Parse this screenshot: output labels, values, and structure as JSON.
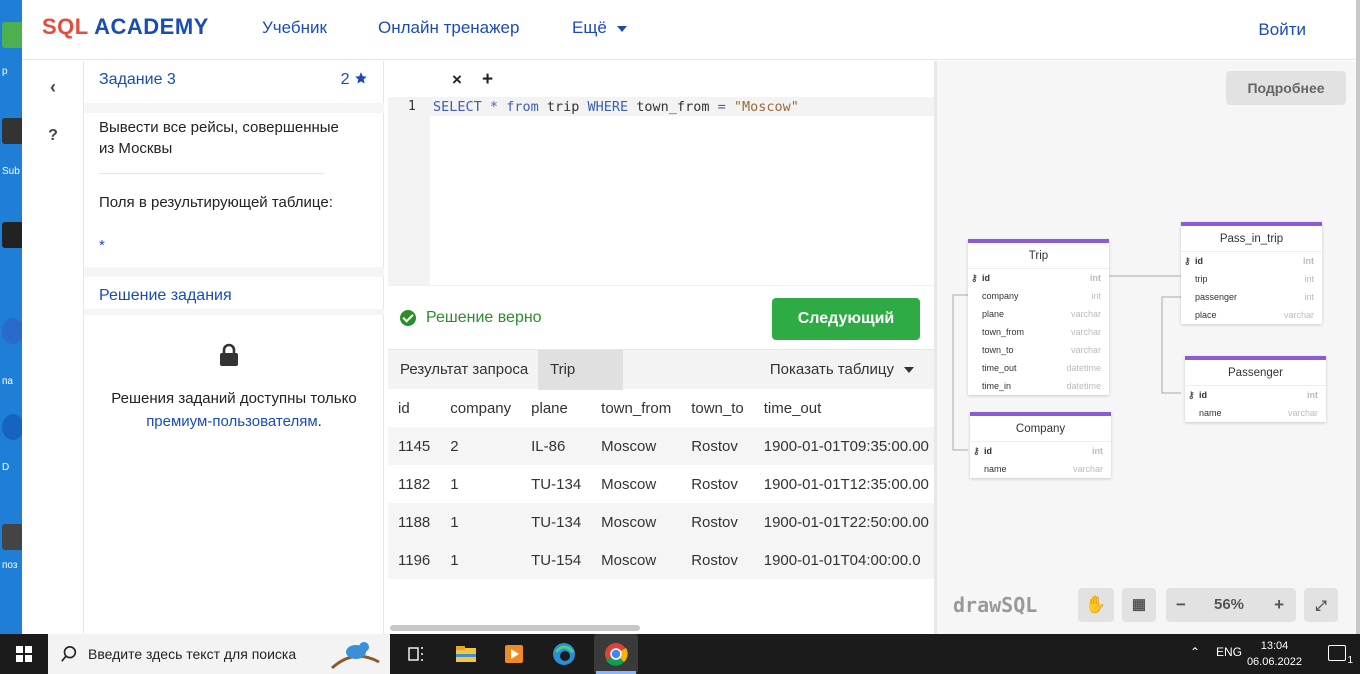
{
  "header": {
    "logo_sql": "SQL",
    "logo_academy": "ACADEMY",
    "nav": [
      "Учебник",
      "Онлайн тренажер",
      "Ещё"
    ],
    "login": "Войти"
  },
  "desktop_labels": [
    "р",
    "Sub",
    "па",
    "D",
    "поз"
  ],
  "mini": {
    "back": "‹",
    "help": "?"
  },
  "task": {
    "title": "Задание 3",
    "score": "2",
    "description": "Вывести все рейсы, совершенные из Москвы",
    "fields_label": "Поля в результирующей таблице:",
    "fields_value": "*",
    "solution_title": "Решение задания",
    "solution_note": "Решения заданий доступны только",
    "solution_link": "премиум-пользователям",
    "solution_dot": "."
  },
  "editor": {
    "close_tab": "×",
    "add_tab": "+",
    "line_number": "1",
    "code": {
      "kw1": "SELECT",
      "star": "*",
      "kw2": "from",
      "table": "trip",
      "kw3": "WHERE",
      "col": "town_from",
      "eq": "=",
      "str": "\"Moscow\""
    }
  },
  "result": {
    "status": "Решение верно",
    "next_button": "Следующий",
    "tabs": [
      "Результат запроса",
      "Trip"
    ],
    "show_table": "Показать таблицу",
    "columns": [
      "id",
      "company",
      "plane",
      "town_from",
      "town_to",
      "time_out"
    ],
    "rows": [
      [
        "1145",
        "2",
        "IL-86",
        "Moscow",
        "Rostov",
        "1900-01-01T09:35:00.00"
      ],
      [
        "1182",
        "1",
        "TU-134",
        "Moscow",
        "Rostov",
        "1900-01-01T12:35:00.00"
      ],
      [
        "1188",
        "1",
        "TU-134",
        "Moscow",
        "Rostov",
        "1900-01-01T22:50:00.00"
      ],
      [
        "1196",
        "1",
        "TU-154",
        "Moscow",
        "Rostov",
        "1900-01-01T04:00:00.0"
      ]
    ]
  },
  "diagram": {
    "more_button": "Подробнее",
    "brand": "drawSQL",
    "zoom": "56%",
    "entities": {
      "trip": {
        "title": "Trip",
        "fields": [
          {
            "name": "id",
            "type": "int"
          },
          {
            "name": "company",
            "type": "int"
          },
          {
            "name": "plane",
            "type": "varchar"
          },
          {
            "name": "town_from",
            "type": "varchar"
          },
          {
            "name": "town_to",
            "type": "varchar"
          },
          {
            "name": "time_out",
            "type": "datetime"
          },
          {
            "name": "time_in",
            "type": "datetime"
          }
        ]
      },
      "pass_in_trip": {
        "title": "Pass_in_trip",
        "fields": [
          {
            "name": "id",
            "type": "int"
          },
          {
            "name": "trip",
            "type": "int"
          },
          {
            "name": "passenger",
            "type": "int"
          },
          {
            "name": "place",
            "type": "varchar"
          }
        ]
      },
      "passenger": {
        "title": "Passenger",
        "fields": [
          {
            "name": "id",
            "type": "int"
          },
          {
            "name": "name",
            "type": "varchar"
          }
        ]
      },
      "company": {
        "title": "Company",
        "fields": [
          {
            "name": "id",
            "type": "int"
          },
          {
            "name": "name",
            "type": "varchar"
          }
        ]
      }
    }
  },
  "taskbar": {
    "search_placeholder": "Введите здесь текст для поиска",
    "lang": "ENG",
    "time": "13:04",
    "date": "06.06.2022",
    "notifications": "1"
  },
  "colors": {
    "brand_blue": "#1a4cb6",
    "brand_red": "#e64b3c",
    "success_green": "#2eab45",
    "entity_accent": "#8b5cd6"
  }
}
